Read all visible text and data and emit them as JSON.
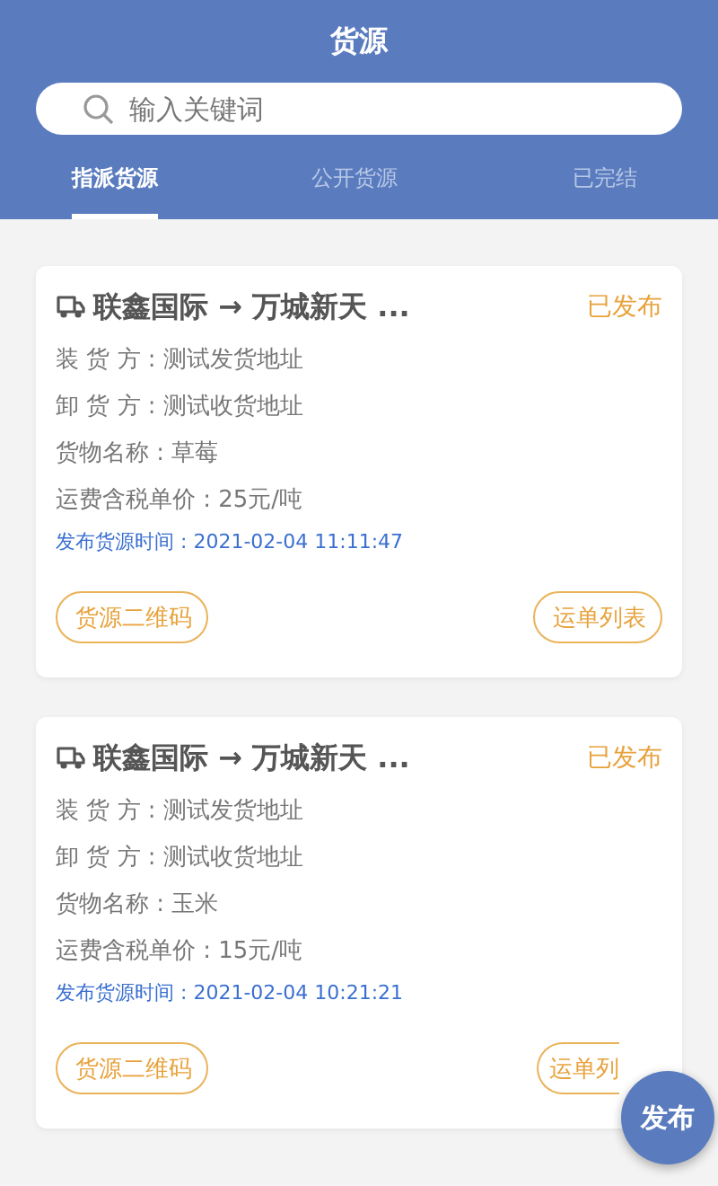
{
  "header": {
    "title": "货源"
  },
  "search": {
    "placeholder": "输入关键词"
  },
  "tabs": [
    {
      "label": "指派货源",
      "selected": true
    },
    {
      "label": "公开货源",
      "selected": false
    },
    {
      "label": "已完结",
      "selected": false
    }
  ],
  "cards": [
    {
      "route": "联鑫国际 → 万城新天 ...",
      "status": "已发布",
      "lines": [
        "装 货 方 : 测试发货地址",
        "卸 货 方 : 测试收货地址",
        "货物名称 : 草莓",
        "运费含税单价 : 25元/吨"
      ],
      "time": "发布货源时间 : 2021-02-04 11:11:47",
      "buttons": [
        "货源二维码",
        "运单列表"
      ]
    },
    {
      "route": "联鑫国际 → 万城新天 ...",
      "status": "已发布",
      "lines": [
        "装 货 方 : 测试发货地址",
        "卸 货 方 : 测试收货地址",
        "货物名称 : 玉米",
        "运费含税单价 : 15元/吨"
      ],
      "time": "发布货源时间 : 2021-02-04 10:21:21",
      "buttons": [
        "货源二维码",
        "运单列"
      ]
    }
  ],
  "fab": {
    "label": "发布"
  }
}
